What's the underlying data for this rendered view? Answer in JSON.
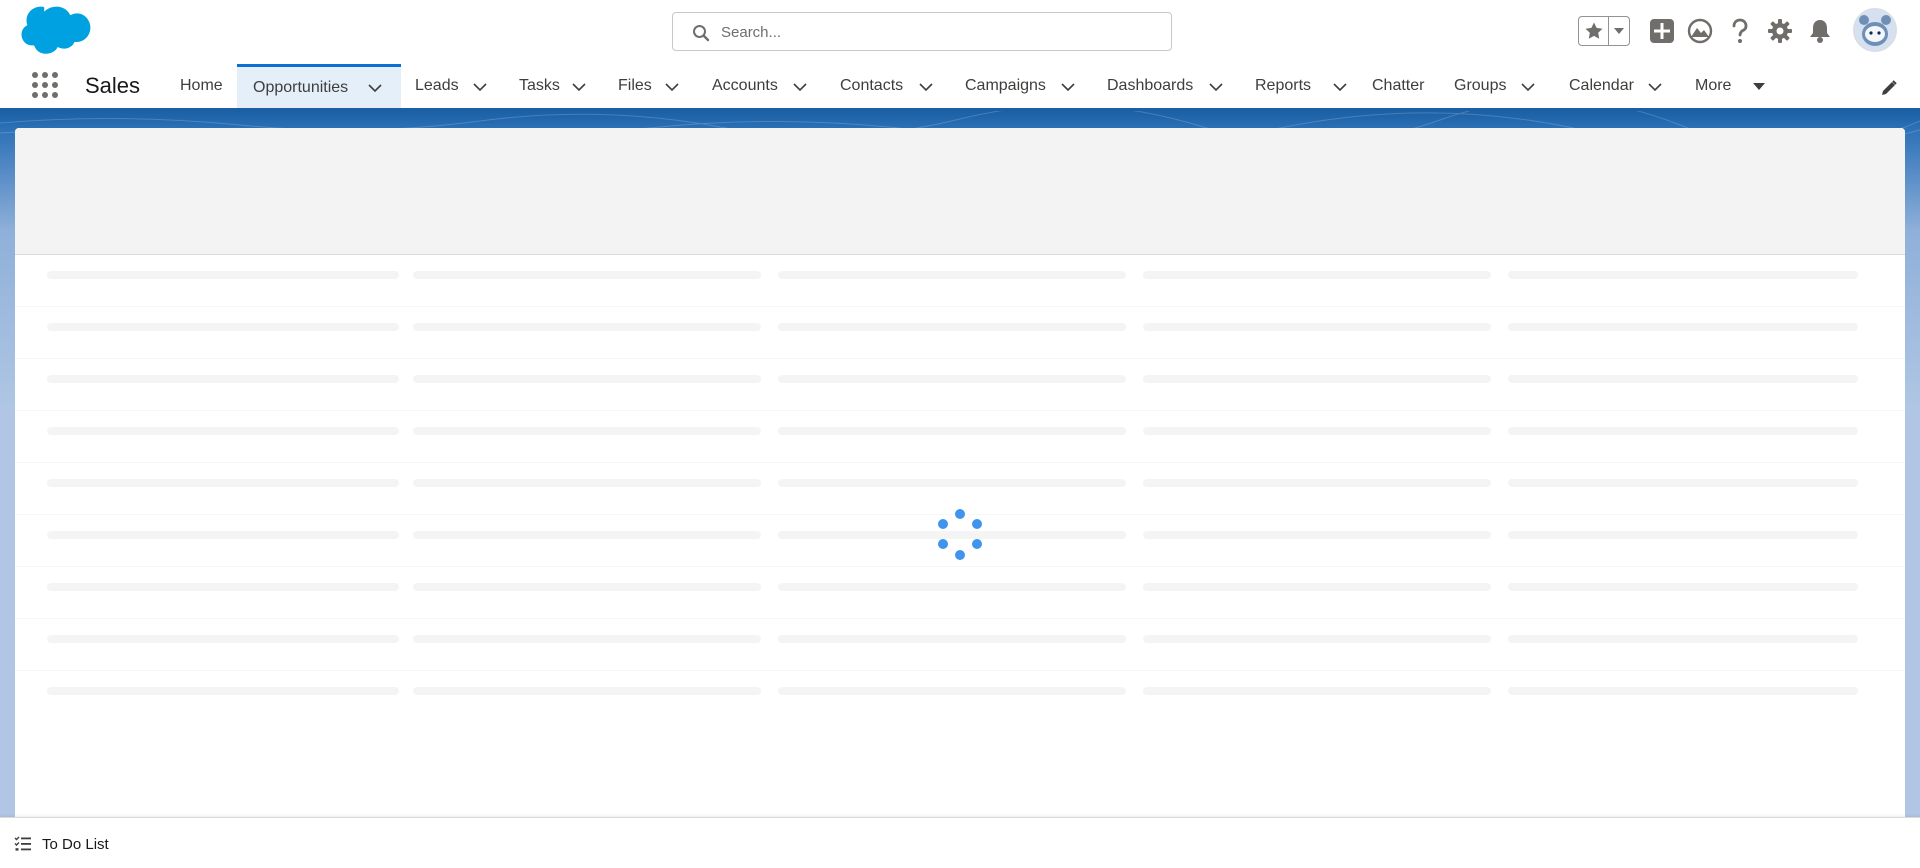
{
  "header": {
    "search_placeholder": "Search...",
    "icons": {
      "logo": "salesforce-cloud-logo",
      "favorites": "star-icon",
      "favorites_menu": "caret-down-icon",
      "global_actions": "plus-icon",
      "trailhead": "trailhead-icon",
      "help": "question-icon",
      "setup": "gear-icon",
      "notifications": "bell-icon",
      "avatar": "astro-avatar"
    }
  },
  "nav": {
    "app_name": "Sales",
    "items": [
      {
        "label": "Home",
        "has_menu": false,
        "active": false
      },
      {
        "label": "Opportunities",
        "has_menu": true,
        "active": true
      },
      {
        "label": "Leads",
        "has_menu": true,
        "active": false
      },
      {
        "label": "Tasks",
        "has_menu": true,
        "active": false
      },
      {
        "label": "Files",
        "has_menu": true,
        "active": false
      },
      {
        "label": "Accounts",
        "has_menu": true,
        "active": false
      },
      {
        "label": "Contacts",
        "has_menu": true,
        "active": false
      },
      {
        "label": "Campaigns",
        "has_menu": true,
        "active": false
      },
      {
        "label": "Dashboards",
        "has_menu": true,
        "active": false
      },
      {
        "label": "Reports",
        "has_menu": true,
        "active": false
      },
      {
        "label": "Chatter",
        "has_menu": false,
        "active": false
      },
      {
        "label": "Groups",
        "has_menu": true,
        "active": false
      },
      {
        "label": "Calendar",
        "has_menu": true,
        "active": false
      },
      {
        "label": "More",
        "has_menu": true,
        "active": false
      }
    ]
  },
  "main": {
    "state": "loading",
    "skeleton_rows": 9,
    "skeleton_columns": 5
  },
  "utility_bar": {
    "items": [
      {
        "label": "To Do List",
        "icon": "checklist-icon"
      }
    ]
  },
  "colors": {
    "brand_blue": "#1b5fa5",
    "active_tab_bg": "#e5effa",
    "active_tab_border": "#0b6fd4",
    "spinner": "#4094ee",
    "logo": "#00a1e0"
  }
}
